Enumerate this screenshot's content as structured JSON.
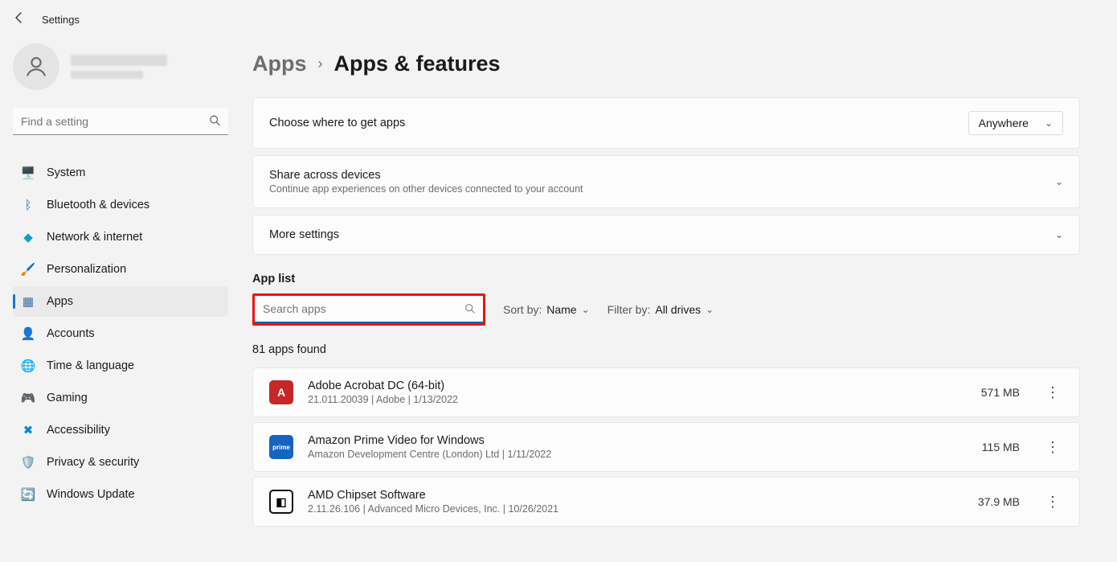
{
  "window": {
    "title": "Settings"
  },
  "search_sidebar": {
    "placeholder": "Find a setting"
  },
  "nav": [
    {
      "icon": "🖥️",
      "label": "System",
      "color": "#1976d2"
    },
    {
      "icon": "ᛒ",
      "label": "Bluetooth & devices",
      "color": "#1976d2"
    },
    {
      "icon": "◆",
      "label": "Network & internet",
      "color": "#00a3cc"
    },
    {
      "icon": "🖌️",
      "label": "Personalization",
      "color": "#d8833b"
    },
    {
      "icon": "▦",
      "label": "Apps",
      "color": "#3a6ea5"
    },
    {
      "icon": "👤",
      "label": "Accounts",
      "color": "#2e7d32"
    },
    {
      "icon": "🌐",
      "label": "Time & language",
      "color": "#0288d1"
    },
    {
      "icon": "🎮",
      "label": "Gaming",
      "color": "#888"
    },
    {
      "icon": "✖",
      "label": "Accessibility",
      "color": "#0288d1"
    },
    {
      "icon": "🛡️",
      "label": "Privacy & security",
      "color": "#888"
    },
    {
      "icon": "🔄",
      "label": "Windows Update",
      "color": "#0288d1"
    }
  ],
  "nav_active_index": 4,
  "breadcrumb": {
    "parent": "Apps",
    "current": "Apps & features"
  },
  "cards": {
    "choose_apps": {
      "title": "Choose where to get apps",
      "dropdown": "Anywhere"
    },
    "share_devices": {
      "title": "Share across devices",
      "subtitle": "Continue app experiences on other devices connected to your account"
    },
    "more_settings": {
      "title": "More settings"
    }
  },
  "app_list": {
    "section_title": "App list",
    "search_placeholder": "Search apps",
    "sort_label": "Sort by:",
    "sort_value": "Name",
    "filter_label": "Filter by:",
    "filter_value": "All drives",
    "found_text": "81 apps found"
  },
  "apps": [
    {
      "name": "Adobe Acrobat DC (64-bit)",
      "meta": "21.011.20039  |  Adobe  |  1/13/2022",
      "size": "571 MB",
      "icon": "adobe",
      "glyph": "A"
    },
    {
      "name": "Amazon Prime Video for Windows",
      "meta": "Amazon Development Centre (London) Ltd  |  1/11/2022",
      "size": "115 MB",
      "icon": "prime",
      "glyph": "prime"
    },
    {
      "name": "AMD Chipset Software",
      "meta": "2.11.26.106  |  Advanced Micro Devices, Inc.  |  10/26/2021",
      "size": "37.9 MB",
      "icon": "amd",
      "glyph": "◧"
    }
  ]
}
